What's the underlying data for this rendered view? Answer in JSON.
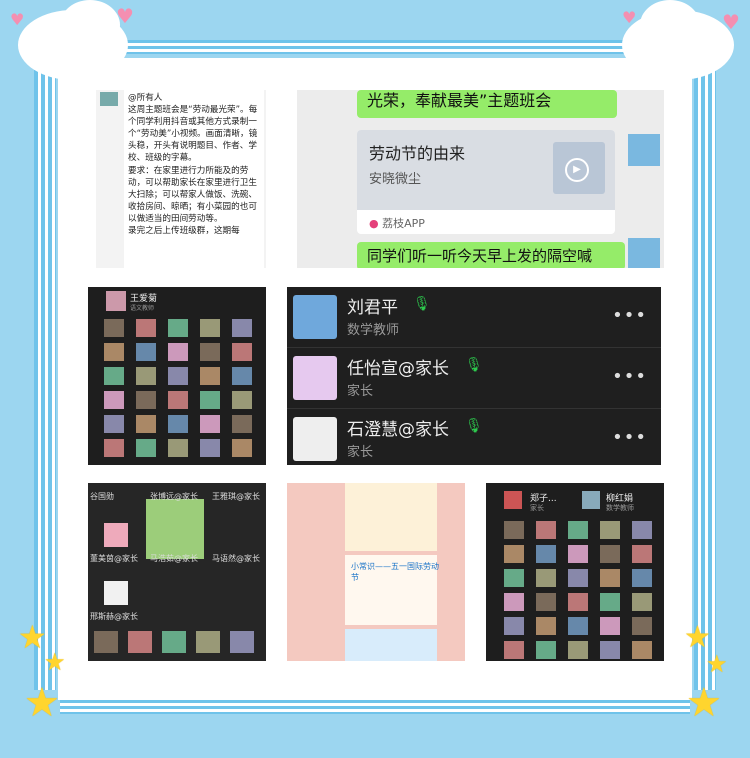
{
  "shot1": {
    "text": "@所有人\n这周主题班会是“劳动最光荣”。每个同学利用抖音或其他方式录制一个“劳动美”小视频。画面清晰，镜头稳，开头有说明题目、作者、学校、班级的字幕。\n要求：在家里进行力所能及的劳动，可以帮助家长在家里进行卫生大扫除；可以帮家人做饭、洗碗、收拾房间、晾晒；有小菜园的也可以做适当的田间劳动等。\n录完之后上传班级群，这期每"
  },
  "shot2": {
    "msg1": "光荣，奉献最美”主题班会",
    "card_title": "劳动节的由来",
    "card_subtitle": "安晓微尘",
    "card_source": "荔枝APP",
    "msg2": "同学们听一听今天早上发的隔空喊"
  },
  "shot3": {
    "name": "王爱菊",
    "role": "语文教师"
  },
  "shot4": {
    "rows": [
      {
        "name": "刘君平",
        "role": "数学教师",
        "more": "•••"
      },
      {
        "name": "任怡宣@家长",
        "role": "家长",
        "more": "•••"
      },
      {
        "name": "石澄慧@家长",
        "role": "家长",
        "more": "•••"
      }
    ]
  },
  "shot5": {
    "labels": [
      "谷国勋",
      "张博远@家长",
      "王雅琪@家长",
      "董美茵@家长",
      "马语然@家长",
      "邢斯赫@家长",
      "马浩茹@家长"
    ]
  },
  "shot6": {
    "title": "小常识——五一国际劳动节"
  },
  "shot7": {
    "name1": "郑子...",
    "role1": "家长",
    "name2": "柳红娟",
    "role2": "数学教师"
  }
}
